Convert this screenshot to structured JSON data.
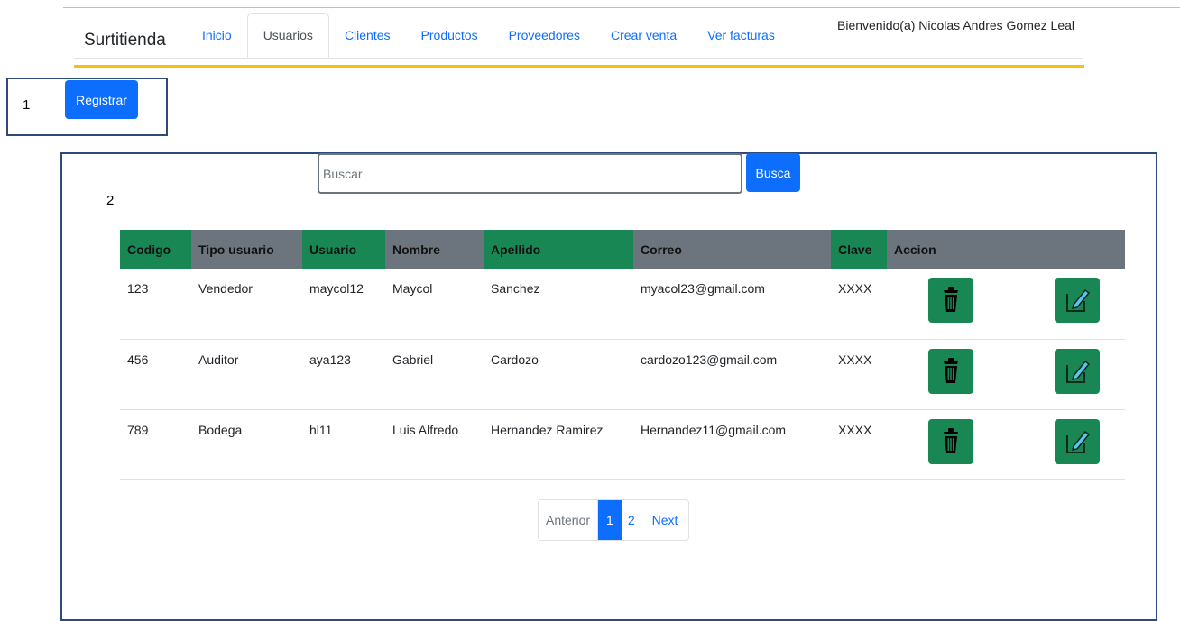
{
  "nav": {
    "brand": "Surtitienda",
    "tabs": [
      {
        "label": "Inicio",
        "active": false
      },
      {
        "label": "Usuarios",
        "active": true
      },
      {
        "label": "Clientes",
        "active": false
      },
      {
        "label": "Productos",
        "active": false
      },
      {
        "label": "Proveedores",
        "active": false
      },
      {
        "label": "Crear venta",
        "active": false
      },
      {
        "label": "Ver facturas",
        "active": false
      }
    ],
    "welcome": "Bienvenido(a) Nicolas Andres Gomez Leal"
  },
  "annotations": {
    "box1_label": "1",
    "box2_label": "2"
  },
  "actions": {
    "register_label": "Registrar"
  },
  "search": {
    "placeholder": "Buscar",
    "button_label": "Busca"
  },
  "table": {
    "headers": [
      "Codigo",
      "Tipo usuario",
      "Usuario",
      "Nombre",
      "Apellido",
      "Correo",
      "Clave",
      "Accion"
    ],
    "rows": [
      [
        "123",
        "Vendedor",
        "maycol12",
        "Maycol",
        "Sanchez",
        "myacol23@gmail.com",
        "XXXX"
      ],
      [
        "456",
        "Auditor",
        "aya123",
        "Gabriel",
        "Cardozo",
        "cardozo123@gmail.com",
        "XXXX"
      ],
      [
        "789",
        "Bodega",
        "hl11",
        "Luis Alfredo",
        "Hernandez Ramirez",
        "Hernandez11@gmail.com",
        "XXXX"
      ]
    ]
  },
  "pagination": {
    "prev": "Anterior",
    "pages": [
      "1",
      "2"
    ],
    "active_page": "1",
    "next": "Next"
  },
  "colors": {
    "primary": "#0d6efd",
    "success": "#198754",
    "secondary": "#6c757d",
    "accent_line": "#f4c20d",
    "annotation_border": "#2c4a7a"
  },
  "icons": {
    "delete": "trash-icon",
    "edit": "pencil-square-icon"
  }
}
